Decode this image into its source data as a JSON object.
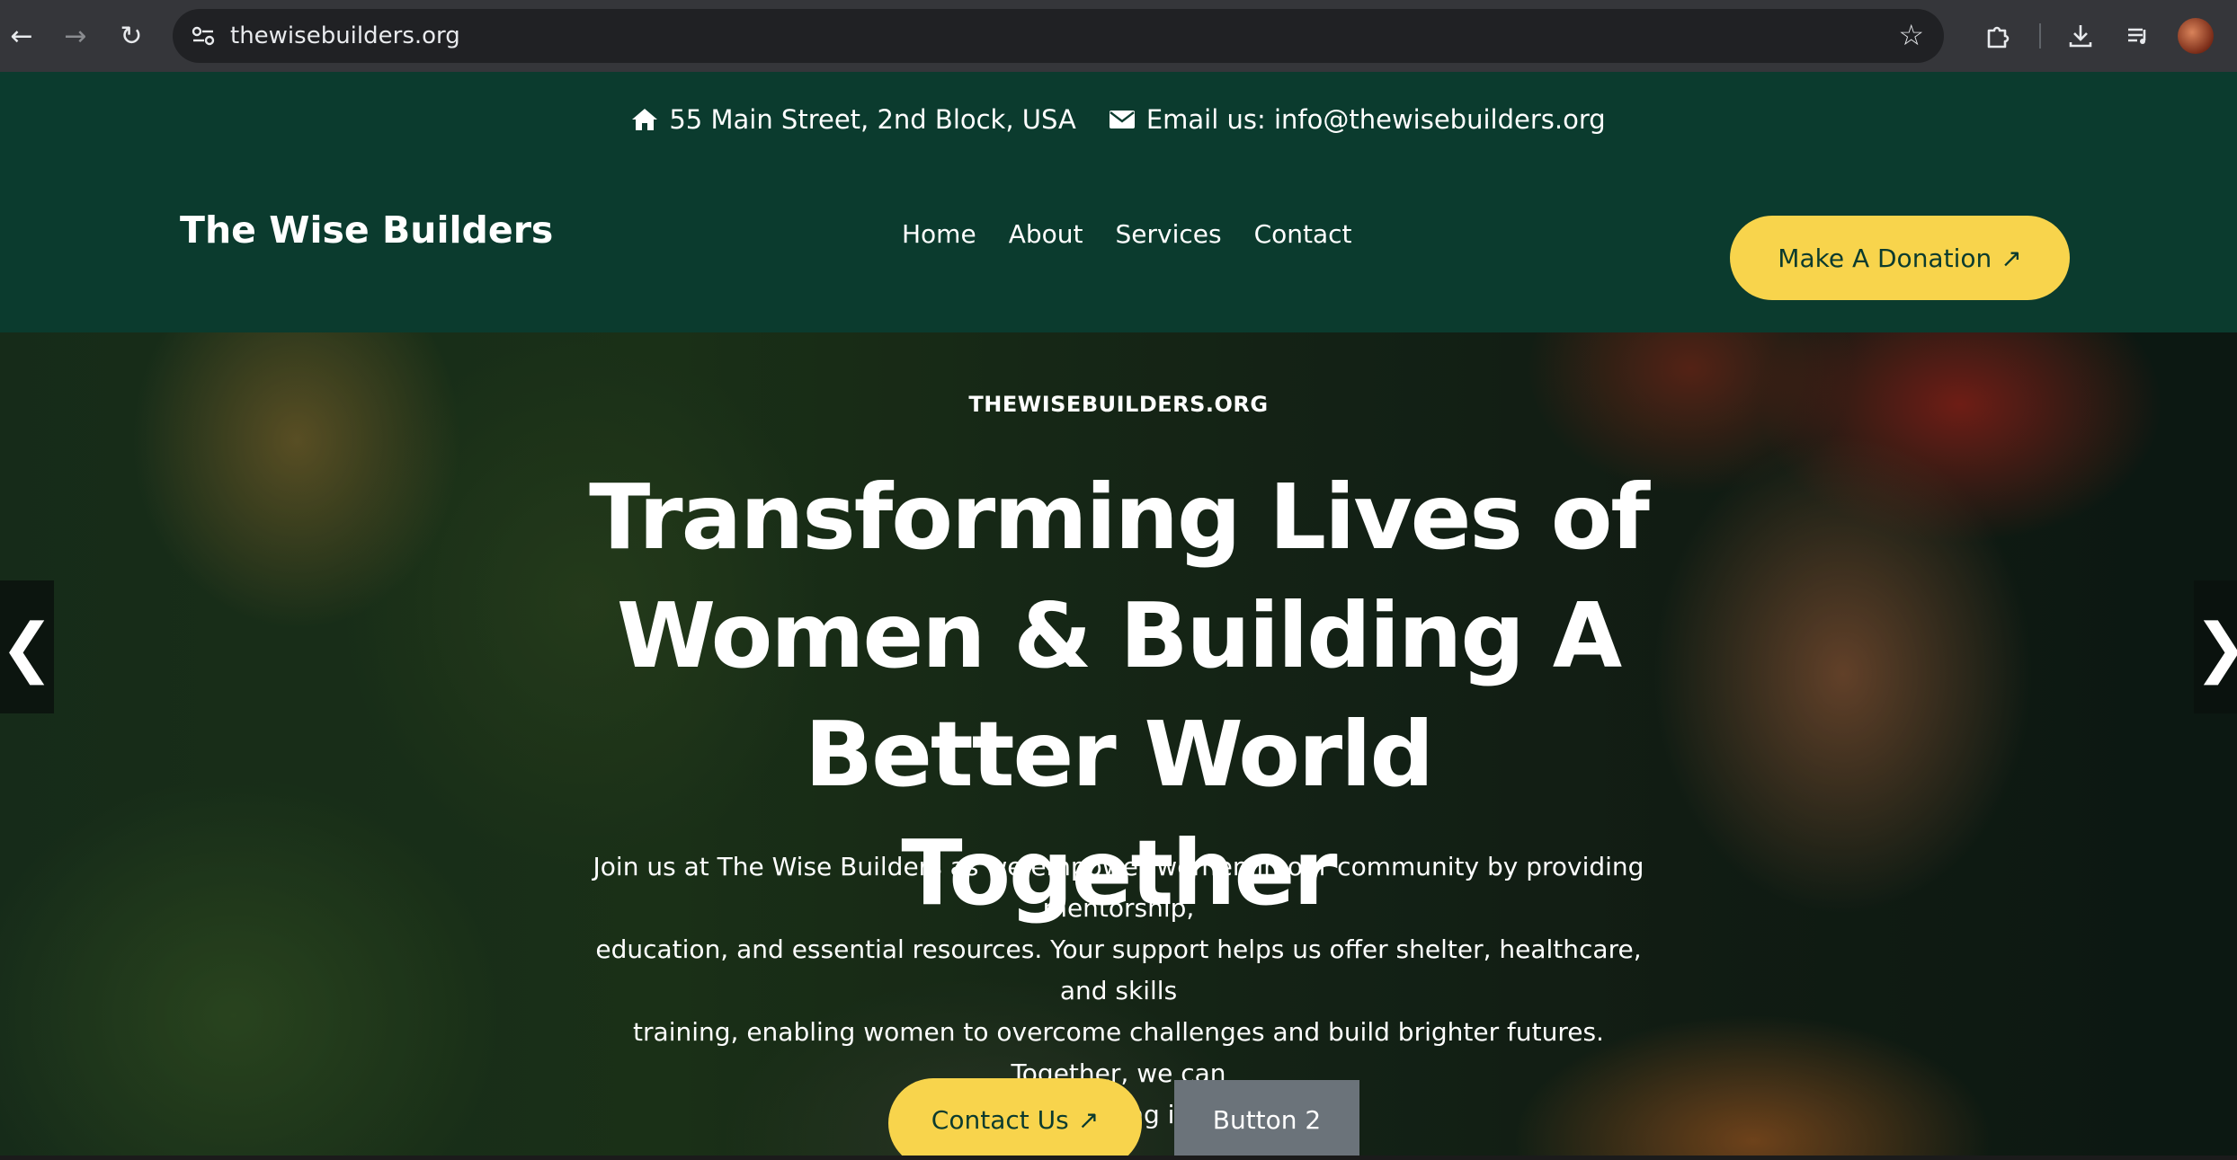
{
  "browser": {
    "url": "thewisebuilders.org",
    "icons": [
      "back-arrow-icon",
      "forward-arrow-icon",
      "reload-icon",
      "site-info-icon",
      "bookmark-star-icon",
      "extensions-icon",
      "download-icon",
      "media-queue-icon",
      "profile-avatar"
    ]
  },
  "topbar": {
    "address": "55 Main Street, 2nd Block, USA",
    "email": "Email us: info@thewisebuilders.org"
  },
  "header": {
    "brand": "The Wise Builders",
    "nav": [
      "Home",
      "About",
      "Services",
      "Contact"
    ],
    "donate_label": "Make A Donation",
    "donate_icon": "↗"
  },
  "hero": {
    "eyebrow": "THEWISEBUILDERS.ORG",
    "headline_lines": [
      "Transforming Lives of",
      "Women & Building A",
      "Better World Together"
    ],
    "lead_lines": [
      "Join us at The Wise Builders as we empower women in our community by providing mentorship,",
      "education, and essential resources. Your support helps us offer shelter, healthcare, and skills",
      "training, enabling women to overcome challenges and build brighter futures. Together, we can",
      "make a lasting impact."
    ],
    "primary_cta": "Contact Us",
    "primary_cta_icon": "↗",
    "secondary_cta": "Button 2",
    "prev_arrow": "❮",
    "next_arrow": "❯"
  },
  "colors": {
    "header_bg": "#0b3b2e",
    "accent": "#f8d44c",
    "secondary_button": "#6b737a"
  }
}
